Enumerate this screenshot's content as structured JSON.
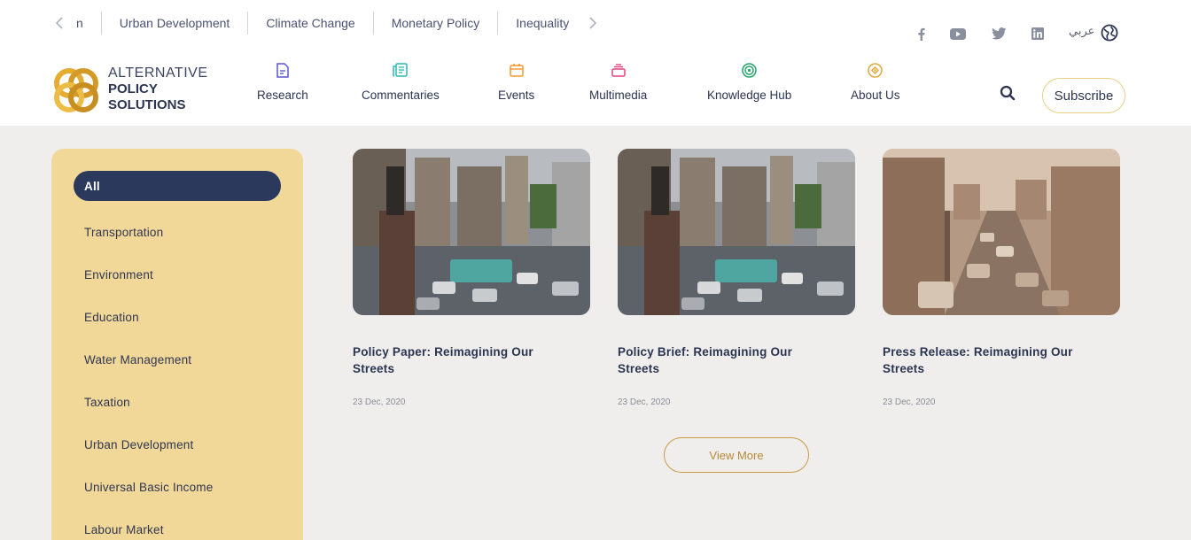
{
  "topics": {
    "partial": "n",
    "items": [
      "Urban Development",
      "Climate Change",
      "Monetary Policy",
      "Inequality"
    ]
  },
  "language_label": "عربي",
  "social_icons": [
    "facebook-icon",
    "youtube-icon",
    "twitter-icon",
    "linkedin-icon"
  ],
  "logo": {
    "line1": "ALTERNATIVE",
    "line2": "POLICY",
    "line3": "SOLUTIONS"
  },
  "nav": [
    {
      "label": "Research",
      "icon": "document-icon",
      "color": "#5b57d6"
    },
    {
      "label": "Commentaries",
      "icon": "notes-icon",
      "color": "#29b9b0"
    },
    {
      "label": "Events",
      "icon": "calendar-icon",
      "color": "#f39a2e"
    },
    {
      "label": "Multimedia",
      "icon": "stack-icon",
      "color": "#e2437a"
    },
    {
      "label": "Knowledge Hub",
      "icon": "target-icon",
      "color": "#28a36a"
    },
    {
      "label": "About Us",
      "icon": "emblem-icon",
      "color": "#e0a93a"
    }
  ],
  "subscribe_label": "Subscribe",
  "categories": [
    "All",
    "Transportation",
    "Environment",
    "Education",
    "Water Management",
    "Taxation",
    "Urban Development",
    "Universal Basic Income",
    "Labour Market"
  ],
  "active_category": "All",
  "cards": [
    {
      "title": "Policy Paper: Reimagining Our Streets",
      "date": "23 Dec, 2020"
    },
    {
      "title": "Policy Brief: Reimagining Our Streets",
      "date": "23 Dec, 2020"
    },
    {
      "title": "Press Release: Reimagining Our Streets",
      "date": "23 Dec, 2020"
    }
  ],
  "view_more_label": "View More",
  "colors": {
    "navy": "#2b3a5c",
    "sidebar": "#f1d798",
    "gold": "#c99a45",
    "background": "#efeeec"
  }
}
